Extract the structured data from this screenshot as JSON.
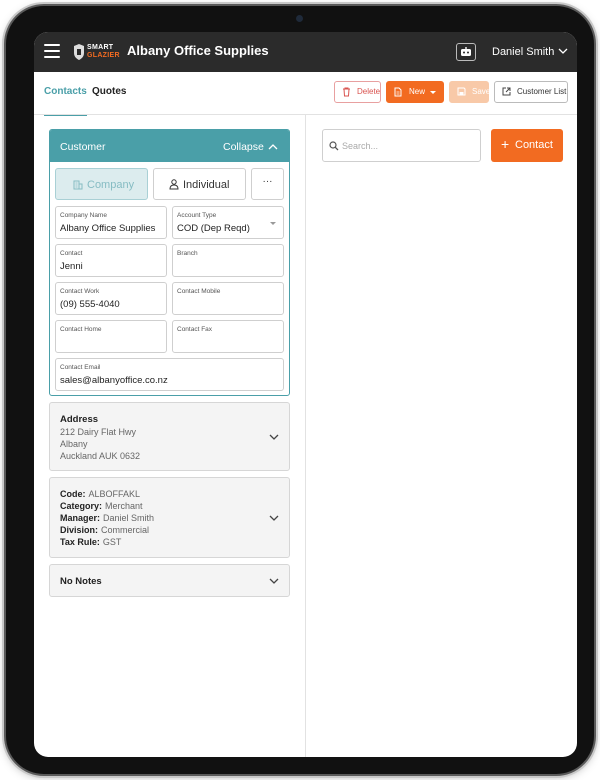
{
  "app": {
    "title": "Albany Office Supplies",
    "logo_line1": "SMART",
    "logo_line2": "GLAZIER",
    "user_name": "Daniel Smith",
    "brand_orange": "#f26b21",
    "brand_teal": "#4a9fa8"
  },
  "tabs": [
    {
      "label": "Contacts",
      "active": true
    },
    {
      "label": "Quotes",
      "active": false
    }
  ],
  "toolbar": {
    "delete_label": "Delete",
    "new_label": "New",
    "save_label": "Save",
    "customer_list_label": "Customer List"
  },
  "customer": {
    "header_title": "Customer",
    "collapse_label": "Collapse",
    "type_company": "Company",
    "type_individual": "Individual",
    "more_label": "···",
    "fields": {
      "company_name": {
        "label": "Company Name",
        "value": "Albany Office Supplies"
      },
      "account_type": {
        "label": "Account Type",
        "value": "COD (Dep Reqd)"
      },
      "contact": {
        "label": "Contact",
        "value": "Jenni"
      },
      "branch": {
        "label": "Branch",
        "value": ""
      },
      "contact_work": {
        "label": "Contact Work",
        "value": "(09) 555-4040"
      },
      "contact_mobile": {
        "label": "Contact Mobile",
        "value": ""
      },
      "contact_home": {
        "label": "Contact Home",
        "value": ""
      },
      "contact_fax": {
        "label": "Contact Fax",
        "value": ""
      },
      "contact_email": {
        "label": "Contact Email",
        "value": "sales@albanyoffice.co.nz"
      }
    }
  },
  "address": {
    "title": "Address",
    "lines": [
      "212 Dairy Flat Hwy",
      "Albany",
      "Auckland AUK 0632"
    ]
  },
  "details": [
    {
      "key": "Code:",
      "value": "ALBOFFAKL"
    },
    {
      "key": "Category:",
      "value": "Merchant"
    },
    {
      "key": "Manager:",
      "value": "Daniel Smith"
    },
    {
      "key": "Division:",
      "value": "Commercial"
    },
    {
      "key": "Tax Rule:",
      "value": "GST"
    }
  ],
  "notes": {
    "title": "No Notes"
  },
  "contacts_pane": {
    "search_placeholder": "Search...",
    "add_contact_label": "Contact",
    "add_symbol": "+"
  }
}
